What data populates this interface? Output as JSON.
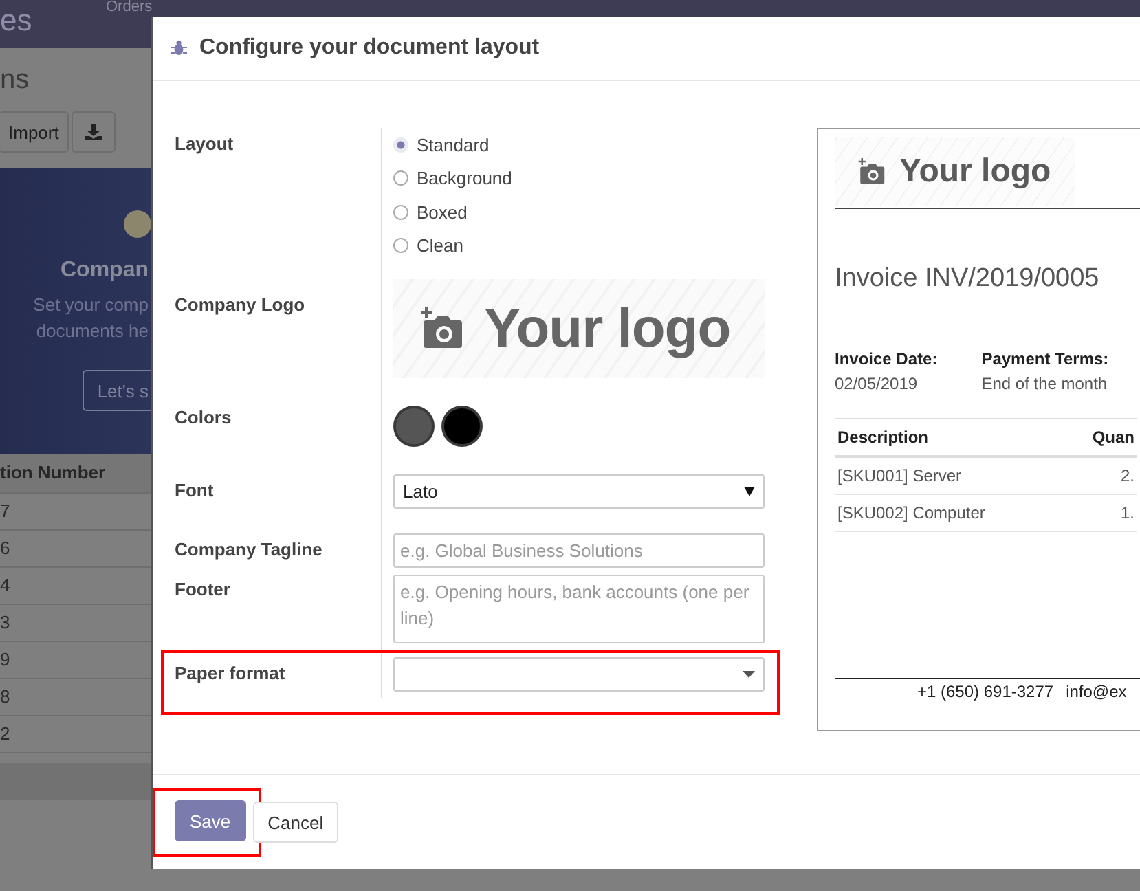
{
  "app": {
    "title": "es",
    "menu": [
      "Orders"
    ]
  },
  "page": {
    "title": "ns",
    "import_button": "Import",
    "banner": {
      "title": "Compan",
      "lines": [
        "Set your comp",
        "documents he"
      ],
      "button": "Let's s"
    },
    "table": {
      "column": "tion Number",
      "rows": [
        "7",
        "6",
        "4",
        "3",
        "9",
        "8",
        "2"
      ]
    }
  },
  "dialog": {
    "title": "Configure your document layout",
    "fields": [
      {
        "kind": "radio",
        "label": "Layout",
        "options": [
          {
            "label": "Standard",
            "selected": true
          },
          {
            "label": "Background",
            "selected": false
          },
          {
            "label": "Boxed",
            "selected": false
          },
          {
            "label": "Clean",
            "selected": false
          }
        ]
      },
      {
        "kind": "logo",
        "label": "Company Logo",
        "text": "Your logo"
      },
      {
        "kind": "colors",
        "label": "Colors",
        "swatches": [
          {
            "color": "#555555"
          },
          {
            "color": "#000000"
          }
        ]
      },
      {
        "kind": "select",
        "label": "Font",
        "value": "Lato"
      },
      {
        "kind": "input",
        "label": "Company Tagline",
        "placeholder": "e.g. Global Business Solutions"
      },
      {
        "kind": "textarea",
        "label": "Footer",
        "placeholder": "e.g. Opening hours, bank accounts (one per line)"
      },
      {
        "kind": "dropdown",
        "label": "Paper format",
        "highlighted": true
      }
    ],
    "preview": {
      "logo": "Your logo",
      "title": "Invoice INV/2019/0005",
      "info": [
        {
          "label": "Invoice Date:",
          "value": "02/05/2019"
        },
        {
          "label": "Payment Terms:",
          "value": "End of the month"
        }
      ],
      "columns": [
        "Description",
        "Quan"
      ],
      "rows": [
        [
          "[SKU001] Server",
          "2."
        ],
        [
          "[SKU002] Computer",
          "1."
        ]
      ],
      "footer": [
        "+1 (650) 691-3277",
        "info@ex"
      ]
    },
    "buttons": [
      {
        "label": "Save",
        "primary": true,
        "highlighted": true
      },
      {
        "label": "Cancel",
        "primary": false,
        "highlighted": false
      }
    ]
  }
}
